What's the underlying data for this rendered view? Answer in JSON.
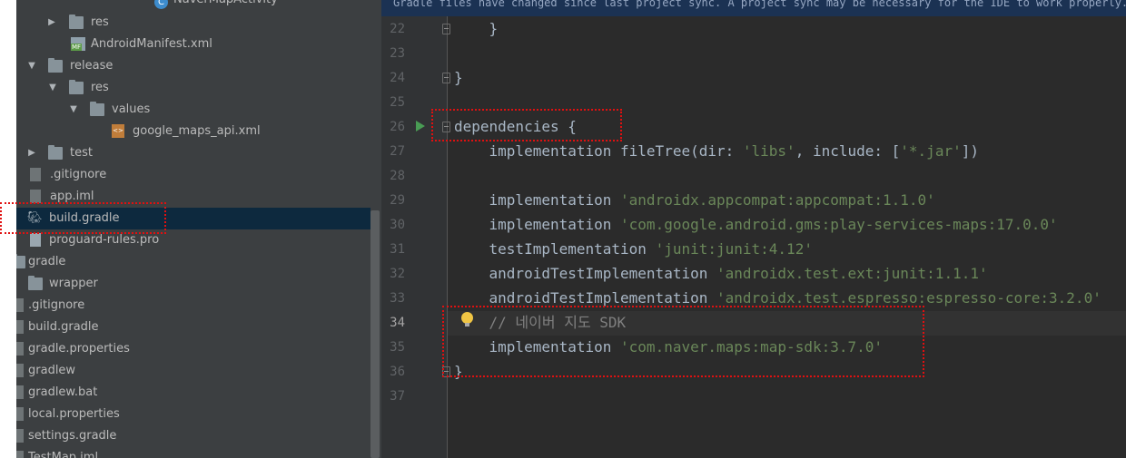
{
  "project_tree": {
    "items": [
      {
        "label": "NaverMapActivity"
      },
      {
        "label": "res"
      },
      {
        "label": "AndroidManifest.xml"
      },
      {
        "label": "release"
      },
      {
        "label": "res"
      },
      {
        "label": "values"
      },
      {
        "label": "google_maps_api.xml"
      },
      {
        "label": "test"
      },
      {
        "label": ".gitignore"
      },
      {
        "label": "app.iml"
      },
      {
        "label": "build.gradle"
      },
      {
        "label": "proguard-rules.pro"
      },
      {
        "label": "gradle"
      },
      {
        "label": "wrapper"
      },
      {
        "label": ".gitignore"
      },
      {
        "label": "build.gradle"
      },
      {
        "label": "gradle.properties"
      },
      {
        "label": "gradlew"
      },
      {
        "label": "gradlew.bat"
      },
      {
        "label": "local.properties"
      },
      {
        "label": "settings.gradle"
      },
      {
        "label": "TestMap.iml"
      }
    ],
    "icons": {
      "folder": "folder-icon",
      "class": "class-icon",
      "manifest": "manifest-icon",
      "xml": "xml-file-icon",
      "gradle": "gradle-icon",
      "file": "file-icon",
      "expanded": "chevron-down-icon",
      "collapsed": "chevron-right-icon"
    },
    "manifest_badge": "MF",
    "class_badge": "C",
    "xml_badge": "<>"
  },
  "editor": {
    "banner": "Gradle files have changed since last project sync. A project sync may be necessary for the IDE to work properly.",
    "lines": [
      {
        "no": "22",
        "code": "    }"
      },
      {
        "no": "23",
        "code": ""
      },
      {
        "no": "24",
        "code": "}"
      },
      {
        "no": "25",
        "code": ""
      },
      {
        "no": "26",
        "code": "dependencies {"
      },
      {
        "no": "27",
        "code_plain": "    implementation fileTree(dir: ",
        "s1": "'libs'",
        "mid": ", include: [",
        "s2": "'*.jar'",
        "end": "])"
      },
      {
        "no": "28",
        "code": ""
      },
      {
        "no": "29",
        "code_plain": "    implementation ",
        "s1": "'androidx.appcompat:appcompat:1.1.0'"
      },
      {
        "no": "30",
        "code_plain": "    implementation ",
        "s1": "'com.google.android.gms:play-services-maps:17.0.0'"
      },
      {
        "no": "31",
        "code_plain": "    testImplementation ",
        "s1": "'junit:junit:4.12'"
      },
      {
        "no": "32",
        "code_plain": "    androidTestImplementation ",
        "s1": "'androidx.test.ext:junit:1.1.1'"
      },
      {
        "no": "33",
        "code_plain": "    androidTestImplementation ",
        "s1": "'androidx.test.espresso:espresso-core:3.2.0'"
      },
      {
        "no": "34",
        "comment": "    // 네이버 지도 SDK"
      },
      {
        "no": "35",
        "code_plain": "    implementation ",
        "s1": "'com.naver.maps:map-sdk:3.7.0'"
      },
      {
        "no": "36",
        "code": "}"
      },
      {
        "no": "37",
        "code": ""
      }
    ],
    "current_line": "34"
  },
  "colors": {
    "tree_bg": "#3c3f41",
    "editor_bg": "#2b2b2b",
    "string": "#6a8759",
    "comment": "#808080",
    "annotation": "#e01010"
  }
}
